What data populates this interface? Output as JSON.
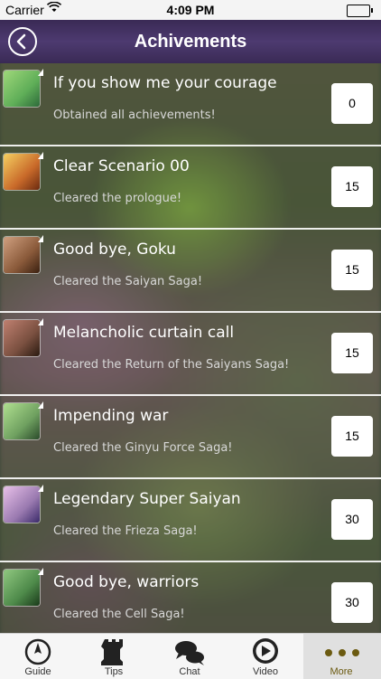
{
  "status_bar": {
    "carrier": "Carrier",
    "time": "4:09 PM"
  },
  "header": {
    "title": "Achivements"
  },
  "achievements": [
    {
      "title": "If you show me your courage",
      "subtitle": "Obtained all achievements!",
      "points": "0",
      "thumb_color": "#5fae58"
    },
    {
      "title": "Clear Scenario 00",
      "subtitle": "Cleared the prologue!",
      "points": "15",
      "thumb_color": "#c96a2a"
    },
    {
      "title": "Good bye, Goku",
      "subtitle": "Cleared the Saiyan Saga!",
      "points": "15",
      "thumb_color": "#8a5a3a"
    },
    {
      "title": "Melancholic curtain call",
      "subtitle": "Cleared the Return of the Saiyans Saga!",
      "points": "15",
      "thumb_color": "#7a5040"
    },
    {
      "title": "Impending war",
      "subtitle": "Cleared the Ginyu Force Saga!",
      "points": "15",
      "thumb_color": "#6fa060"
    },
    {
      "title": "Legendary Super Saiyan",
      "subtitle": "Cleared the Frieza Saga!",
      "points": "30",
      "thumb_color": "#9a7ab0"
    },
    {
      "title": "Good bye, warriors",
      "subtitle": "Cleared the Cell Saga!",
      "points": "30",
      "thumb_color": "#4e8a4a"
    }
  ],
  "tabs": [
    {
      "label": "Guide",
      "icon": "compass-icon"
    },
    {
      "label": "Tips",
      "icon": "chess-rook-icon"
    },
    {
      "label": "Chat",
      "icon": "chat-bubbles-icon"
    },
    {
      "label": "Video",
      "icon": "play-icon"
    },
    {
      "label": "More",
      "icon": "more-dots-icon"
    }
  ]
}
